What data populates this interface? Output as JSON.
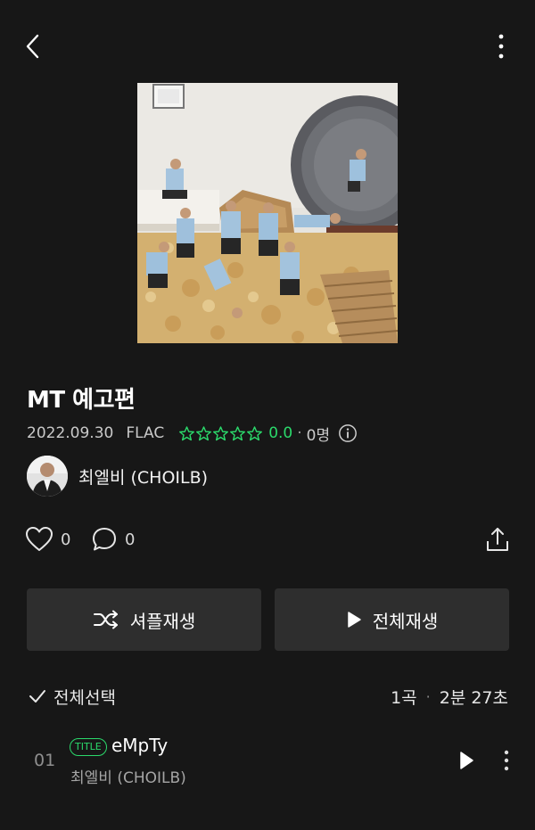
{
  "header": {
    "back_icon": "chevron-left-icon",
    "more_icon": "vertical-dots-icon"
  },
  "album": {
    "title": "MT 예고편",
    "release_date": "2022.09.30",
    "format": "FLAC",
    "rating": "0.0",
    "rating_stars": 0,
    "rating_max": 5,
    "raters": "0명",
    "cover_description": "cover-art-photo"
  },
  "artist": {
    "name": "최엘비 (CHOILB)"
  },
  "social": {
    "likes": "0",
    "comments": "0",
    "share_icon": "share-icon"
  },
  "actions": {
    "shuffle_label": "셔플재생",
    "play_all_label": "전체재생"
  },
  "list": {
    "select_all_label": "전체선택",
    "track_count": "1곡",
    "separator": "·",
    "total_duration": "2분 27초"
  },
  "tracks": [
    {
      "number": "01",
      "badge": "TITLE",
      "title": "eMpTy",
      "artist": "최엘비 (CHOILB)"
    }
  ],
  "colors": {
    "background": "#171717",
    "accent_green": "#2bd96b",
    "button_bg": "#2e2e2e"
  }
}
